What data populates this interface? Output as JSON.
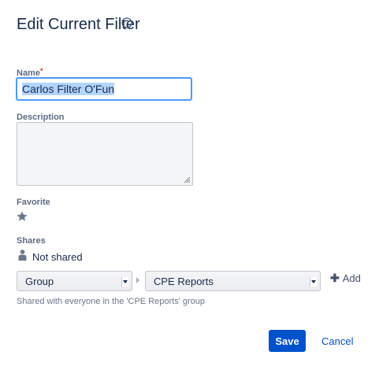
{
  "dialog": {
    "title": "Edit Current Filter",
    "help_icon": "help-circle-icon"
  },
  "form": {
    "name": {
      "label": "Name",
      "required_marker": "*",
      "value": "Carlos Filter O'Fun"
    },
    "description": {
      "label": "Description",
      "value": ""
    },
    "favorite": {
      "label": "Favorite",
      "icon": "star-icon"
    },
    "shares": {
      "label": "Shares",
      "status_icon": "person-icon",
      "status_text": "Not shared",
      "share_type_select": "Group",
      "group_select": "CPE Reports",
      "add_label": "Add",
      "helper_text": "Shared with everyone in the 'CPE Reports' group"
    }
  },
  "actions": {
    "save_label": "Save",
    "cancel_label": "Cancel"
  },
  "colors": {
    "primary": "#0052cc",
    "focus_border": "#4c9aff",
    "required": "#de350b",
    "text": "#172b4d",
    "label": "#5e6c84"
  }
}
